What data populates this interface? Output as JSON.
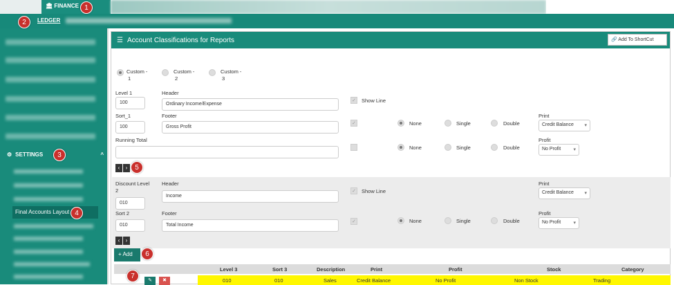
{
  "top_tab": {
    "icon": "bank-icon",
    "label": "FINANCE"
  },
  "sub_tab": {
    "label": "LEDGER"
  },
  "sidebar": {
    "settings_label": "SETTINGS",
    "active_item": "Final Accounts Layout"
  },
  "panel": {
    "title": "Account Classifications for Reports",
    "shortcut_label": "Add To ShortCut"
  },
  "custom_options": [
    {
      "label_a": "Custom -",
      "label_b": "1",
      "selected": true
    },
    {
      "label_a": "Custom -",
      "label_b": "2",
      "selected": false
    },
    {
      "label_a": "Custom -",
      "label_b": "3",
      "selected": false
    }
  ],
  "level1": {
    "level_label": "Level 1",
    "level_value": "100",
    "header_label": "Header",
    "header_value": "Ordinary Income/Expense",
    "show_line": "Show Line",
    "sort_label": "Sort_1",
    "sort_value": "100",
    "footer_label": "Footer",
    "footer_value": "Gross Profit",
    "opt_none": "None",
    "opt_single": "Single",
    "opt_double": "Double",
    "print_label": "Print",
    "print_value": "Credit Balance",
    "running_total_label": "Running Total",
    "profit_label": "Profit",
    "profit_value": "No Profit"
  },
  "level2": {
    "level_label_a": "Discount Level",
    "level_label_b": "2",
    "level_value": "010",
    "header_label": "Header",
    "header_value": "Income",
    "show_line": "Show Line",
    "print_label": "Print",
    "print_value": "Credit Balance",
    "sort_label": "Sort 2",
    "sort_value": "010",
    "footer_label": "Footer",
    "footer_value": "Total Income",
    "opt_none": "None",
    "opt_single": "Single",
    "opt_double": "Double",
    "profit_label": "Profit",
    "profit_value": "No Profit"
  },
  "add_button": "Add",
  "table": {
    "headers": [
      "Level 3",
      "Sort 3",
      "Description",
      "Print",
      "Profit",
      "Stock",
      "Category"
    ],
    "rows": [
      [
        "010",
        "010",
        "Sales",
        "Credit Balance",
        "No Profit",
        "Non Stock",
        "Trading"
      ]
    ]
  },
  "badges": [
    "1",
    "2",
    "3",
    "4",
    "5",
    "6",
    "7"
  ],
  "colors": {
    "accent": "#198b7b",
    "highlight": "#fff700",
    "badge": "#c9302c"
  }
}
